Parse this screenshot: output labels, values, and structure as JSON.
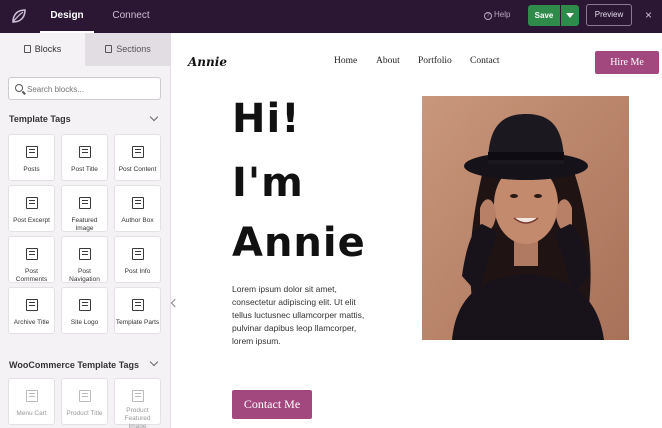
{
  "topbar": {
    "tabs": [
      "Design",
      "Connect"
    ],
    "help_label": "Help",
    "save_label": "Save",
    "preview_label": "Preview",
    "close_label": "×"
  },
  "sidebar": {
    "tabs": [
      "Blocks",
      "Sections"
    ],
    "search_placeholder": "Search blocks...",
    "groups": [
      {
        "title": "Template Tags",
        "blocks": [
          "Posts",
          "Post Title",
          "Post Content",
          "Post Excerpt",
          "Featured Image",
          "Author Box",
          "Post Comments",
          "Post Navigation",
          "Post Info",
          "Archive Title",
          "Site Logo",
          "Template Parts"
        ]
      },
      {
        "title": "WooCommerce Template Tags",
        "blocks": [
          "Menu Cart",
          "Product Title",
          "Product Featured Image"
        ]
      }
    ]
  },
  "page": {
    "brand": "Annie",
    "menu": [
      "Home",
      "About",
      "Portfolio",
      "Contact"
    ],
    "hire_label": "Hire Me",
    "hero_lines": [
      "Hi!",
      "I'm",
      "Annie"
    ],
    "body_text": "Lorem ipsum dolor sit amet, consectetur adipiscing elit. Ut elit tellus luctusnec ullamcorper mattis, pulvinar dapibus leop llamcorper, lorem ipsum.",
    "contact_label": "Contact Me"
  },
  "colors": {
    "topbar": "#2b1633",
    "accent": "#a3487e",
    "save": "#2e8b4a"
  }
}
